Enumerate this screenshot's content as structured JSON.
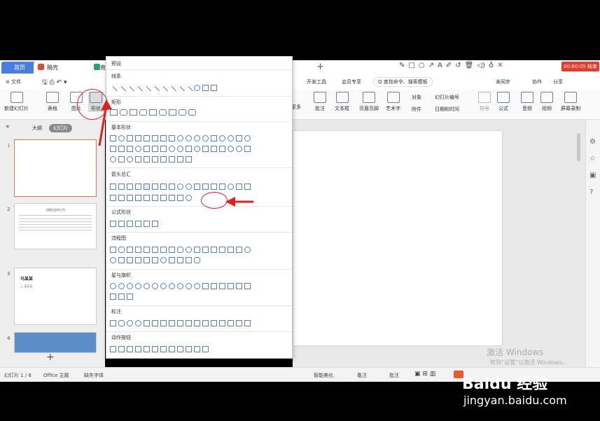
{
  "titlebar": {
    "tab_home": "首页",
    "tab_doc": "稿壳",
    "tab_current": "直",
    "plus": "+",
    "recording": "00:00:05 结束"
  },
  "menu": {
    "file": "≡ 文件",
    "items": [
      "开发工具",
      "会员专享"
    ],
    "search": "Q 查找命令、搜索模板",
    "sync": "未同步",
    "collab": "协作",
    "share": "分享"
  },
  "ribbon": {
    "left": [
      "新建幻灯片",
      "表格",
      "图片",
      "形状"
    ],
    "right": [
      "更多",
      "批注",
      "文本框",
      "页眉页脚",
      "艺术字",
      "符号",
      "公式",
      "音频",
      "视频",
      "屏幕录制"
    ],
    "small": [
      "对象",
      "附件",
      "幻灯片编号",
      "日期和时间"
    ]
  },
  "leftpanel": {
    "tab_outline": "大纲",
    "tab_slides": "幻灯片",
    "collapse": "«",
    "slides": [
      {
        "num": "1"
      },
      {
        "num": "2",
        "title": "大理往返的工作"
      },
      {
        "num": "3",
        "title": "马某某",
        "subtitle": "上 某某某"
      },
      {
        "num": "4"
      }
    ],
    "add": "+"
  },
  "dropdown": {
    "header": "预设",
    "sections": [
      "线条",
      "矩形",
      "基本形状",
      "箭头总汇",
      "公式形状",
      "流程图",
      "星与旗帜",
      "标注",
      "动作按钮"
    ]
  },
  "statusbar": {
    "slide_count": "幻灯片 1 / 6",
    "theme": "Office 主题",
    "font_missing": "缺失字体",
    "beautify": "智能美化",
    "notes": "备注",
    "comments": "批注"
  },
  "watermark": {
    "activate": "激活 Windows",
    "activate_sub": "转到“设置”以激活 Windows。",
    "logo": "Baidu 经验",
    "url": "jingyan.baidu.com"
  },
  "colors": {
    "accent": "#4a7de0",
    "record": "#e33b2e",
    "annotation": "#e02020",
    "shape_stroke": "#5c7fb8"
  }
}
